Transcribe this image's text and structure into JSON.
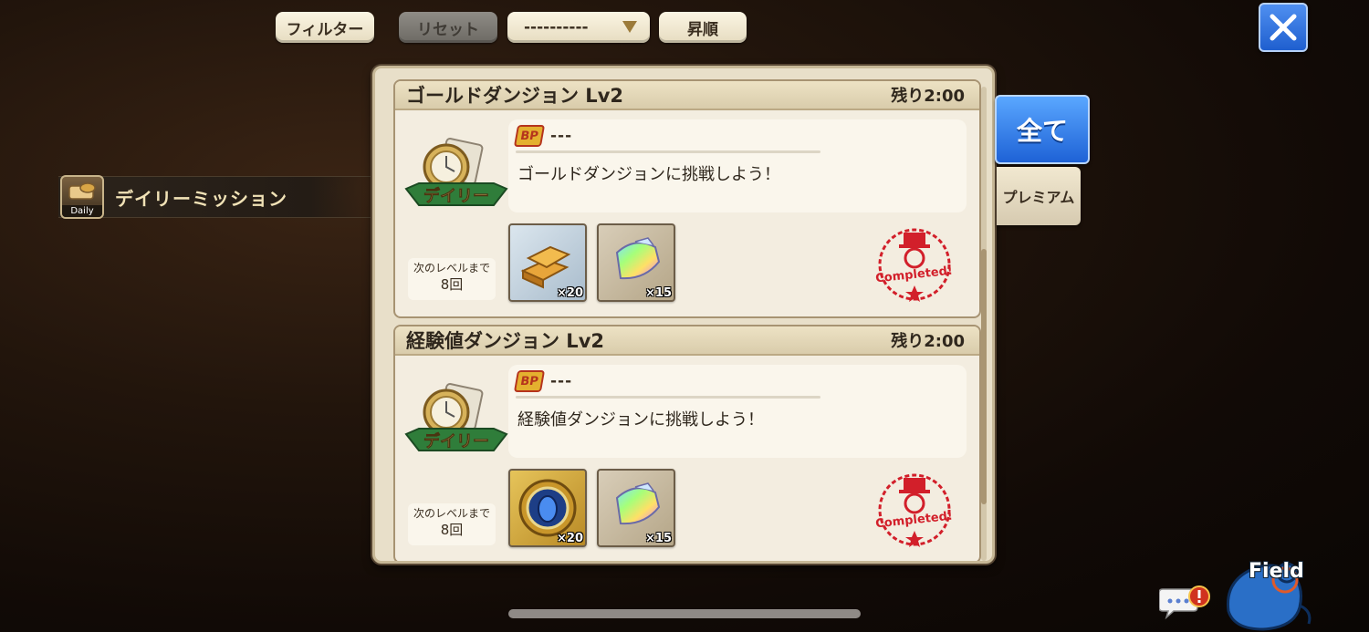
{
  "toolbar": {
    "filter_label": "フィルター",
    "reset_label": "リセット",
    "sort_select_value": "----------",
    "order_label": "昇順"
  },
  "category": {
    "label": "デイリーミッション",
    "icon_tag": "Daily",
    "icon": "daily-mission-icon"
  },
  "tabs": {
    "all_label": "全て",
    "premium_label": "プレミアム"
  },
  "missions": [
    {
      "title": "ゴールドダンジョン Lv2",
      "remaining": "残り2:00",
      "badge": "デイリー",
      "bp_label": "BP",
      "bp_value": "---",
      "description": "ゴールドダンジョンに挑戦しよう！",
      "next_level_label": "次のレベルまで",
      "next_level_value": "8回",
      "rewards": [
        {
          "icon": "gold-bars-icon",
          "quantity": "×20"
        },
        {
          "icon": "rainbow-crystal-icon",
          "quantity": "×15"
        }
      ],
      "stamp": "Completed!"
    },
    {
      "title": "経験値ダンジョン Lv2",
      "remaining": "残り2:00",
      "badge": "デイリー",
      "bp_label": "BP",
      "bp_value": "---",
      "description": "経験値ダンジョンに挑戦しよう！",
      "next_level_label": "次のレベルまで",
      "next_level_value": "8回",
      "rewards": [
        {
          "icon": "exp-orb-icon",
          "quantity": "×20"
        },
        {
          "icon": "rainbow-crystal-icon",
          "quantity": "×15"
        }
      ],
      "stamp": "Completed!"
    }
  ],
  "field": {
    "label": "Field"
  },
  "colors": {
    "accent_blue": "#1e62d6",
    "panel_bg": "#e8dfc9",
    "stamp_red": "#d21f2a"
  }
}
